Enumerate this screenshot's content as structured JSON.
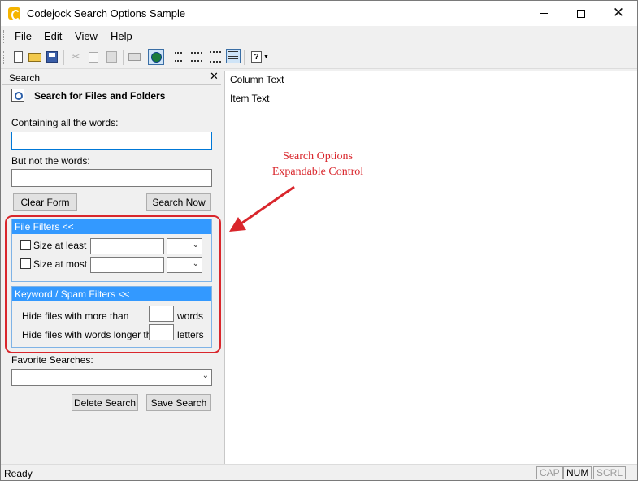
{
  "window": {
    "title": "Codejock Search Options Sample"
  },
  "menu": {
    "items": [
      "File",
      "Edit",
      "View",
      "Help"
    ]
  },
  "toolbar": {
    "buttons": [
      "new-icon",
      "open-icon",
      "save-icon",
      "cut-icon",
      "copy-icon",
      "paste-icon",
      "print-icon",
      "search-icon",
      "list-view-icon",
      "detail-list-icon",
      "details-view-icon",
      "help-icon"
    ]
  },
  "search_pane": {
    "title": "Search",
    "close_glyph": "✕",
    "header": "Search for Files and Folders",
    "containing_label": "Containing all the words:",
    "containing_value": "",
    "but_not_label": "But not the words:",
    "but_not_value": "",
    "clear_button": "Clear Form",
    "search_button": "Search Now",
    "file_filters": {
      "header": "File Filters <<",
      "size_at_least": "Size at least",
      "size_at_most": "Size at most"
    },
    "keyword_filters": {
      "header": "Keyword / Spam Filters <<",
      "more_than_label": "Hide files with more than",
      "more_than_unit": "words",
      "longer_than_label": "Hide files with words longer than",
      "longer_than_unit": "letters"
    },
    "favorite_label": "Favorite Searches:",
    "favorite_value": "",
    "delete_button": "Delete Search",
    "save_button": "Save Search"
  },
  "list_view": {
    "column_header": "Column Text",
    "row": "Item Text"
  },
  "annotation": {
    "line1": "Search Options",
    "line2": "Expandable Control",
    "color": "#d9262c"
  },
  "status": {
    "text": "Ready",
    "indicators": [
      "CAP",
      "NUM",
      "SCRL"
    ],
    "active": [
      "NUM"
    ]
  },
  "colors": {
    "accent": "#3399ff",
    "highlight": "#d9262c"
  }
}
